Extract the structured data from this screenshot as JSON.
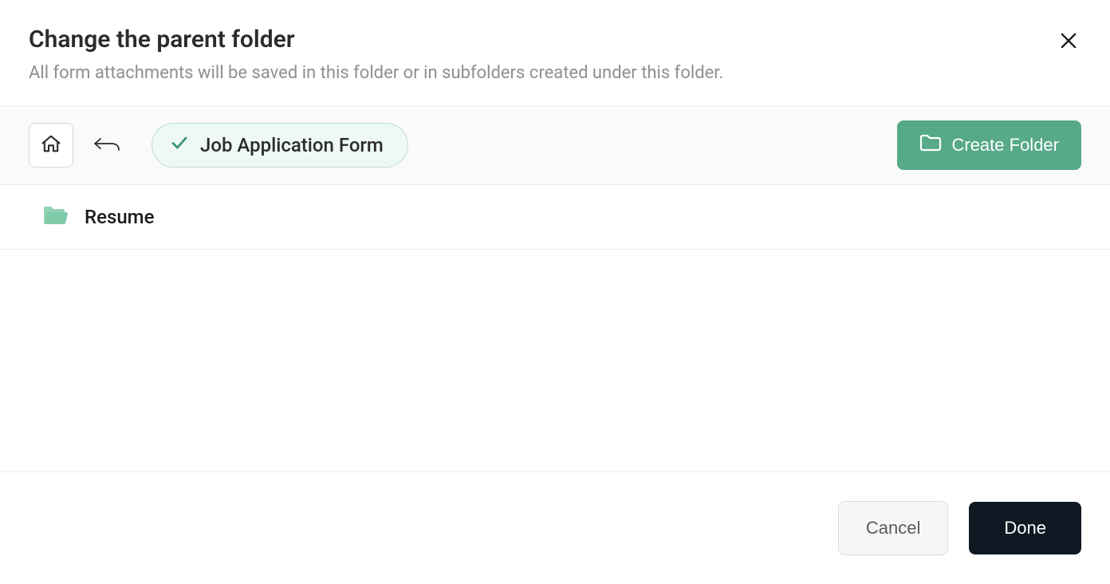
{
  "header": {
    "title": "Change the parent folder",
    "subtitle": "All form attachments will be saved in this folder or in subfolders created under this folder."
  },
  "toolbar": {
    "current_folder": "Job Application Form",
    "create_folder_label": "Create Folder"
  },
  "folders": [
    {
      "name": "Resume"
    }
  ],
  "footer": {
    "cancel_label": "Cancel",
    "done_label": "Done"
  }
}
